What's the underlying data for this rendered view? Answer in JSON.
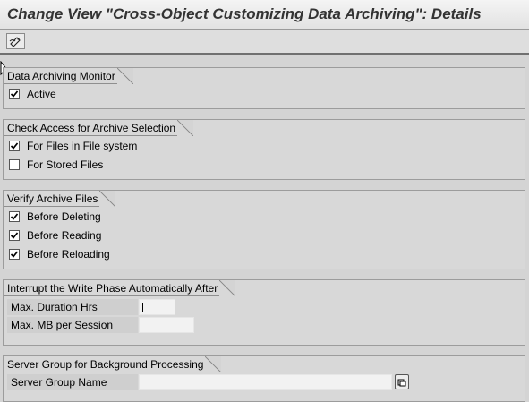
{
  "window": {
    "title": "Change View \"Cross-Object Customizing Data Archiving\": Details"
  },
  "toolbar": {
    "items": [
      {
        "icon": "display-change-icon"
      }
    ]
  },
  "sections": {
    "monitor": {
      "title": "Data Archiving Monitor",
      "items": [
        {
          "label": "Active",
          "checked": true
        }
      ]
    },
    "access": {
      "title": "Check Access for Archive Selection",
      "items": [
        {
          "label": "For Files in File system",
          "checked": true
        },
        {
          "label": "For Stored Files",
          "checked": false
        }
      ]
    },
    "verify": {
      "title": "Verify Archive Files",
      "items": [
        {
          "label": "Before Deleting",
          "checked": true
        },
        {
          "label": "Before Reading",
          "checked": true
        },
        {
          "label": "Before Reloading",
          "checked": true
        }
      ]
    },
    "interrupt": {
      "title": "Interrupt the Write Phase Automatically After",
      "fields": [
        {
          "label": "Max. Duration Hrs",
          "value": ""
        },
        {
          "label": "Max. MB per Session",
          "value": ""
        }
      ]
    },
    "server": {
      "title": "Server Group for Background Processing",
      "fields": [
        {
          "label": "Server Group Name",
          "value": ""
        }
      ]
    }
  },
  "colors": {
    "background": "#d4d4d4",
    "group_border": "#9c9c9c",
    "input_bg": "#f2f2f2"
  }
}
